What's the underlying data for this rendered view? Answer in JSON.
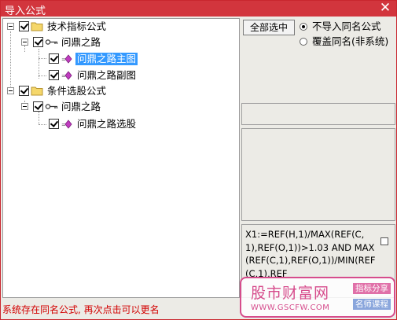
{
  "window": {
    "title": "导入公式",
    "close_glyph": "✕"
  },
  "tree": {
    "root1": {
      "label": "技术指标公式"
    },
    "group1": {
      "label": "问鼎之路"
    },
    "item1": {
      "label": "问鼎之路主图"
    },
    "item2": {
      "label": "问鼎之路副图"
    },
    "root2": {
      "label": "条件选股公式"
    },
    "group2": {
      "label": "问鼎之路"
    },
    "item3": {
      "label": "问鼎之路选股"
    }
  },
  "controls": {
    "select_all_label": "全部选中",
    "radio1_label": "不导入同名公式",
    "radio2_label": "覆盖同名(非系统)"
  },
  "formula_text": "X1:=REF(H,1)/MAX(REF(C,1),REF(O,1))>1.03    AND MAX(REF(C,1),REF(O,1))/MIN(REF(C,1),REF",
  "status_text": "系统存在同名公式, 再次点击可以更名",
  "watermark": {
    "name": "股市财富网",
    "url": "WWW.GSCFW.COM",
    "tag1": "指标分享",
    "tag2": "名师课程"
  },
  "colors": {
    "titlebar": "#d2353d",
    "selection": "#3399ff",
    "status": "#d20000",
    "watermark": "#d64c8c"
  }
}
